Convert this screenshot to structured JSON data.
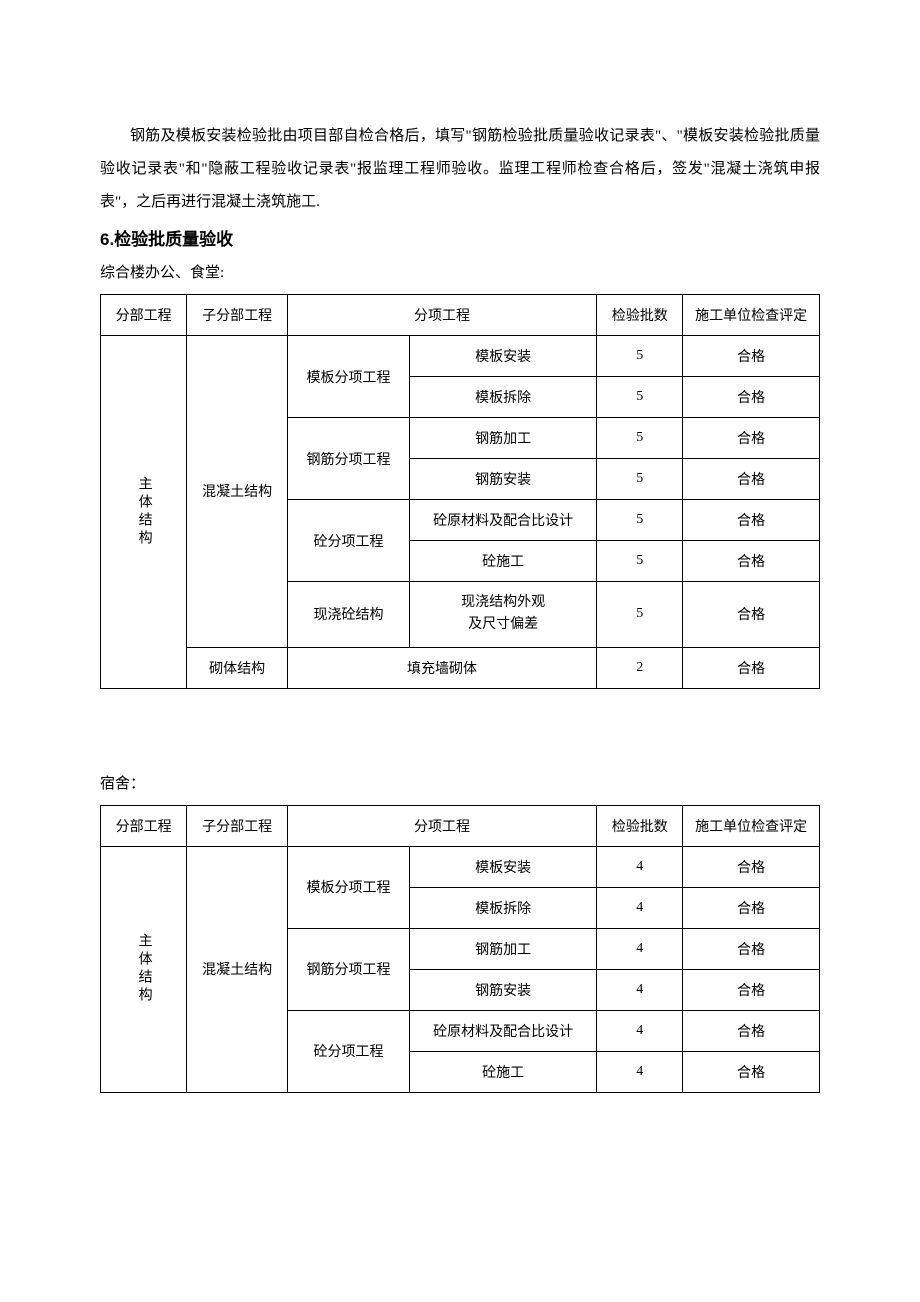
{
  "paragraph": "钢筋及模板安装检验批由项目部自检合格后，填写\"钢筋检验批质量验收记录表\"、\"模板安装检验批质量验收记录表\"和\"隐蔽工程验收记录表\"报监理工程师验收。监理工程师检查合格后，签发\"混凝土浇筑申报表\"，之后再进行混凝土浇筑施工.",
  "section_heading": "6.检验批质量验收",
  "table1": {
    "caption": "综合楼办公、食堂:",
    "headers": {
      "h1": "分部工程",
      "h2": "子分部工程",
      "h3": "分项工程",
      "h4": "检验批数",
      "h5": "施工单位检查评定"
    },
    "col1": "主体结构",
    "col2a": "混凝土结构",
    "col2b": "砌体结构",
    "groups": {
      "g1": "模板分项工程",
      "g2": "钢筋分项工程",
      "g3": "砼分项工程",
      "g4": "现浇砼结构"
    },
    "rows": [
      {
        "item": "模板安装",
        "count": "5",
        "result": "合格"
      },
      {
        "item": "模板拆除",
        "count": "5",
        "result": "合格"
      },
      {
        "item": "钢筋加工",
        "count": "5",
        "result": "合格"
      },
      {
        "item": "钢筋安装",
        "count": "5",
        "result": "合格"
      },
      {
        "item": "砼原材料及配合比设计",
        "count": "5",
        "result": "合格"
      },
      {
        "item": "砼施工",
        "count": "5",
        "result": "合格"
      },
      {
        "item_l1": "现浇结构外观",
        "item_l2": "及尺寸偏差",
        "count": "5",
        "result": "合格"
      }
    ],
    "masonry": {
      "item": "填充墙砌体",
      "count": "2",
      "result": "合格"
    }
  },
  "table2": {
    "caption": "宿舍：",
    "headers": {
      "h1": "分部工程",
      "h2": "子分部工程",
      "h3": "分项工程",
      "h4": "检验批数",
      "h5": "施工单位检查评定"
    },
    "col1": "主体结构",
    "col2a": "混凝土结构",
    "groups": {
      "g1": "模板分项工程",
      "g2": "钢筋分项工程",
      "g3": "砼分项工程"
    },
    "rows": [
      {
        "item": "模板安装",
        "count": "4",
        "result": "合格"
      },
      {
        "item": "模板拆除",
        "count": "4",
        "result": "合格"
      },
      {
        "item": "钢筋加工",
        "count": "4",
        "result": "合格"
      },
      {
        "item": "钢筋安装",
        "count": "4",
        "result": "合格"
      },
      {
        "item": "砼原材料及配合比设计",
        "count": "4",
        "result": "合格"
      },
      {
        "item": "砼施工",
        "count": "4",
        "result": "合格"
      }
    ]
  }
}
